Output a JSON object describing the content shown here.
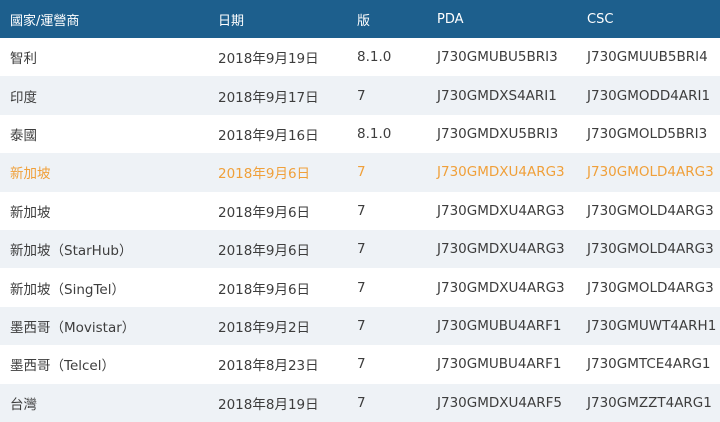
{
  "colors": {
    "header_bg": "#1d5f8d",
    "header_text": "#ffffff",
    "row_text": "#3d3d3d",
    "row_alt_bg": "#eef2f6",
    "highlight_text": "#f0a03a"
  },
  "header": [
    "國家/運營商",
    "日期",
    "版",
    "PDA",
    "CSC"
  ],
  "rows": [
    [
      "智利",
      "2018年9月19日",
      "8.1.0",
      "J730GMUBU5BRI3",
      "J730GMUUB5BRI4"
    ],
    [
      "印度",
      "2018年9月17日",
      "7",
      "J730GMDXS4ARI1",
      "J730GMODD4ARI1"
    ],
    [
      "泰國",
      "2018年9月16日",
      "8.1.0",
      "J730GMDXU5BRI3",
      "J730GMOLD5BRI3"
    ],
    [
      "新加坡",
      "2018年9月6日",
      "7",
      "J730GMDXU4ARG3",
      "J730GMOLD4ARG3"
    ],
    [
      "新加坡",
      "2018年9月6日",
      "7",
      "J730GMDXU4ARG3",
      "J730GMOLD4ARG3"
    ],
    [
      "新加坡（StarHub）",
      "2018年9月6日",
      "7",
      "J730GMDXU4ARG3",
      "J730GMOLD4ARG3"
    ],
    [
      "新加坡（SingTel）",
      "2018年9月6日",
      "7",
      "J730GMDXU4ARG3",
      "J730GMOLD4ARG3"
    ],
    [
      "墨西哥（Movistar）",
      "2018年9月2日",
      "7",
      "J730GMUBU4ARF1",
      "J730GMUWT4ARH1"
    ],
    [
      "墨西哥（Telcel）",
      "2018年8月23日",
      "7",
      "J730GMUBU4ARF1",
      "J730GMTCE4ARG1"
    ],
    [
      "台灣",
      "2018年8月19日",
      "7",
      "J730GMDXU4ARF5",
      "J730GMZZT4ARG1"
    ]
  ]
}
